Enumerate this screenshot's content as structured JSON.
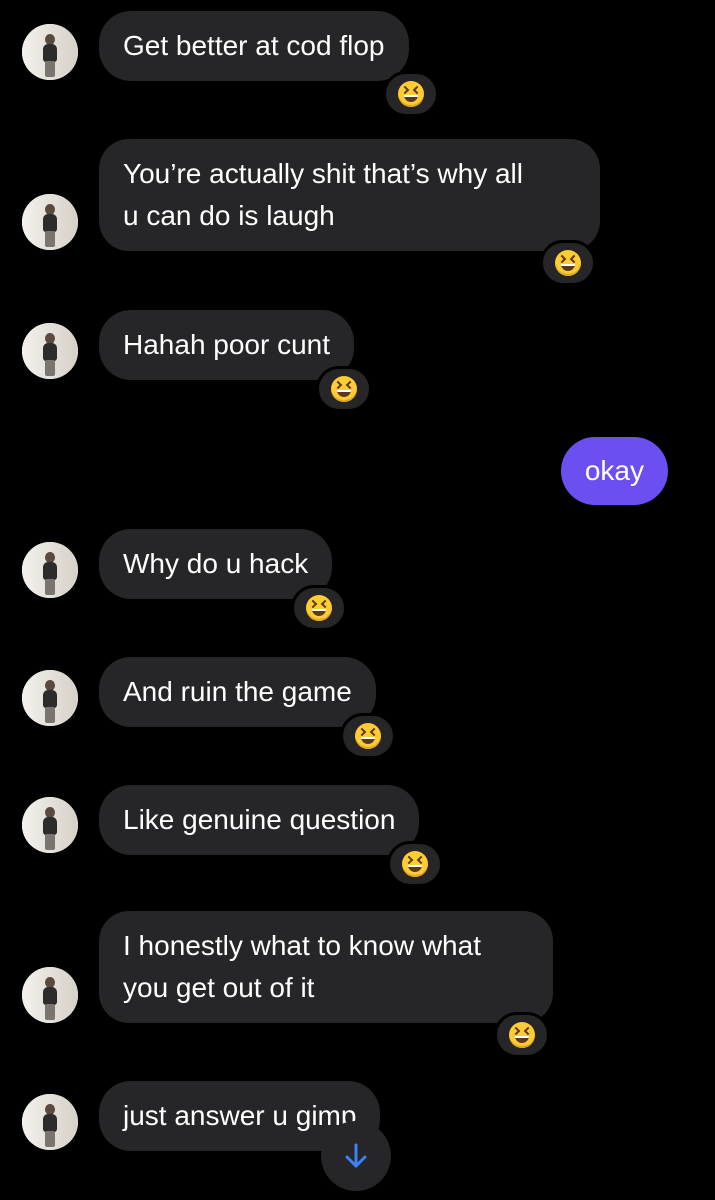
{
  "conversation": {
    "messages": [
      {
        "sender": "them",
        "text": "Get better at cod flop",
        "reaction": "laughing-emoji"
      },
      {
        "sender": "them",
        "lines": [
          "You’re actually shit that’s why all",
          "u can do is laugh"
        ],
        "reaction": "laughing-emoji"
      },
      {
        "sender": "them",
        "text": "Hahah poor cunt",
        "reaction": "laughing-emoji"
      },
      {
        "sender": "me",
        "text": "okay"
      },
      {
        "sender": "them",
        "text": "Why do u hack",
        "reaction": "laughing-emoji"
      },
      {
        "sender": "them",
        "text": "And ruin the game",
        "reaction": "laughing-emoji"
      },
      {
        "sender": "them",
        "text": "Like genuine question",
        "reaction": "laughing-emoji"
      },
      {
        "sender": "them",
        "lines": [
          "I honestly what to know what",
          "you get out of it"
        ],
        "reaction": "laughing-emoji"
      },
      {
        "sender": "them",
        "text": "just answer u gimp"
      }
    ]
  },
  "colors": {
    "background": "#000000",
    "incoming_bubble": "#262628",
    "outgoing_bubble": "#6c4ff0",
    "scroll_arrow": "#3b82f6"
  },
  "controls": {
    "scroll_to_bottom_icon": "arrow-down-icon"
  }
}
